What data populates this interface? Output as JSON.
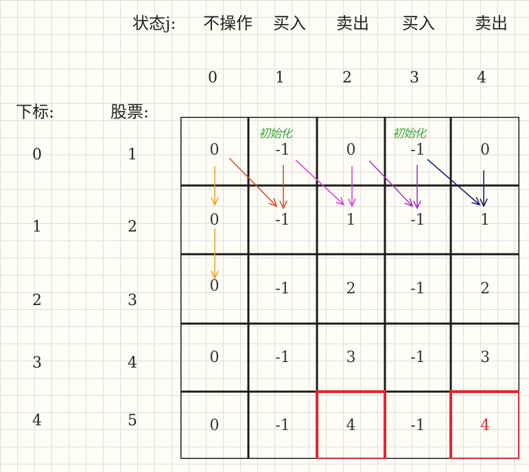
{
  "header": {
    "state_label": "状态j:",
    "states": [
      "不操作",
      "买入",
      "卖出",
      "买入",
      "卖出"
    ],
    "indices": [
      "0",
      "1",
      "2",
      "3",
      "4"
    ]
  },
  "row_labels": {
    "index_title": "下标:",
    "price_title": "股票:",
    "indices": [
      "0",
      "1",
      "2",
      "3",
      "4"
    ],
    "prices": [
      "1",
      "2",
      "3",
      "4",
      "5"
    ]
  },
  "table": [
    [
      "0",
      "-1",
      "0",
      "-1",
      "0"
    ],
    [
      "0",
      "-1",
      "1",
      "-1",
      "1"
    ],
    [
      "0",
      "-1",
      "2",
      "-1",
      "2"
    ],
    [
      "0",
      "-1",
      "3",
      "-1",
      "3"
    ],
    [
      "0",
      "-1",
      "4",
      "-1",
      "4"
    ]
  ],
  "annotations": {
    "init_note": "初始化"
  },
  "colors": {
    "highlight_border": "#e8232f",
    "highlight_text": "#e8232f",
    "arrow_col0": "#f0a020",
    "arrow_col1": "#e8452a",
    "arrow_col2": "#e040d8",
    "arrow_col3": "#a830c8",
    "arrow_col4": "#1a1a6e",
    "note": "#3aa83a"
  }
}
